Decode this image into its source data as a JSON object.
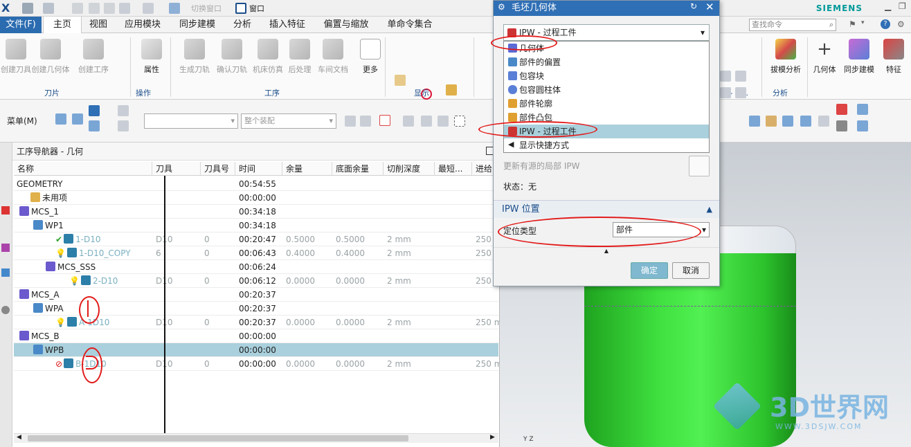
{
  "qat": {
    "switch_window": "切换窗口",
    "window_menu": "窗口",
    "brand": "SIEMENS"
  },
  "menubar": {
    "file": "文件(F)",
    "tabs": [
      "主页",
      "视图",
      "应用模块",
      "同步建模",
      "分析",
      "插入特征",
      "偏置与缩放",
      "单命令集合"
    ],
    "search_placeholder": "查找命令"
  },
  "ribbon": {
    "buttons": [
      "创建刀具",
      "创建几何体",
      "创建工序",
      "属性",
      "生成刀轨",
      "确认刀轨",
      "机床仿真",
      "后处理",
      "车间文档",
      "更多"
    ],
    "right_buttons": [
      "拔模分析",
      "几何体",
      "同步建模",
      "特征"
    ],
    "groups": [
      "刀片",
      "操作",
      "工序",
      "显示",
      "分析"
    ],
    "right_group_partial": "具 - G..."
  },
  "toolbar2": {
    "menu": "菜单(M)",
    "filter_placeholder": "",
    "assembly": "整个装配"
  },
  "navigator": {
    "title": "工序导航器 - 几何",
    "columns": [
      "名称",
      "刀具",
      "刀具号",
      "时间",
      "余量",
      "底面余量",
      "切削深度",
      "最短...",
      "进给"
    ],
    "rows": [
      {
        "name": "GEOMETRY",
        "tool": "",
        "num": "",
        "time": "00:54:55",
        "stock": "",
        "floor": "",
        "depth": "",
        "feed": ""
      },
      {
        "name": "未用项",
        "tool": "",
        "num": "",
        "time": "00:00:00",
        "stock": "",
        "floor": "",
        "depth": "",
        "feed": ""
      },
      {
        "name": "MCS_1",
        "tool": "",
        "num": "",
        "time": "00:34:18",
        "stock": "",
        "floor": "",
        "depth": "",
        "feed": ""
      },
      {
        "name": "WP1",
        "tool": "",
        "num": "",
        "time": "00:34:18",
        "stock": "",
        "floor": "",
        "depth": "",
        "feed": ""
      },
      {
        "name": "1-D10",
        "tool": "D10",
        "num": "0",
        "time": "00:20:47",
        "stock": "0.5000",
        "floor": "0.5000",
        "depth": "2 mm",
        "feed": "250"
      },
      {
        "name": "1-D10_COPY",
        "tool": "6",
        "num": "0",
        "time": "00:06:43",
        "stock": "0.4000",
        "floor": "0.4000",
        "depth": "2 mm",
        "feed": "250"
      },
      {
        "name": "MCS_SSS",
        "tool": "",
        "num": "",
        "time": "00:06:24",
        "stock": "",
        "floor": "",
        "depth": "",
        "feed": ""
      },
      {
        "name": "2-D10",
        "tool": "D10",
        "num": "0",
        "time": "00:06:12",
        "stock": "0.0000",
        "floor": "0.0000",
        "depth": "2 mm",
        "feed": "250"
      },
      {
        "name": "MCS_A",
        "tool": "",
        "num": "",
        "time": "00:20:37",
        "stock": "",
        "floor": "",
        "depth": "",
        "feed": ""
      },
      {
        "name": "WPA",
        "tool": "",
        "num": "",
        "time": "00:20:37",
        "stock": "",
        "floor": "",
        "depth": "",
        "feed": ""
      },
      {
        "name": "A-1D10",
        "tool": "D10",
        "num": "0",
        "time": "00:20:37",
        "stock": "0.0000",
        "floor": "0.0000",
        "depth": "2 mm",
        "feed": "250 m"
      },
      {
        "name": "MCS_B",
        "tool": "",
        "num": "",
        "time": "00:00:00",
        "stock": "",
        "floor": "",
        "depth": "",
        "feed": ""
      },
      {
        "name": "WPB",
        "tool": "",
        "num": "",
        "time": "00:00:00",
        "stock": "",
        "floor": "",
        "depth": "",
        "feed": ""
      },
      {
        "name": "B-1D10",
        "tool": "D10",
        "num": "0",
        "time": "00:00:00",
        "stock": "0.0000",
        "floor": "0.0000",
        "depth": "2 mm",
        "feed": "250 m"
      }
    ]
  },
  "dialog": {
    "title": "毛坯几何体",
    "type_value": "IPW - 过程工件",
    "dropdown": [
      "几何体",
      "部件的偏置",
      "包容块",
      "包容圆柱体",
      "部件轮廓",
      "部件凸包",
      "IPW - 过程工件",
      "显示快捷方式"
    ],
    "update_ipw": "更新有源的局部 IPW",
    "status": "状态：无",
    "section2": "IPW 位置",
    "position_type_label": "定位类型",
    "position_type_value": "部件",
    "ok": "确定",
    "cancel": "取消"
  },
  "watermark": {
    "brand": "3D世界网",
    "url": "WWW.3DSJW.COM"
  },
  "colors": {
    "accent": "#2f6fb5",
    "selection": "#a9d0dc",
    "part": "#3fe03f",
    "annotation": "#e21b1b"
  }
}
